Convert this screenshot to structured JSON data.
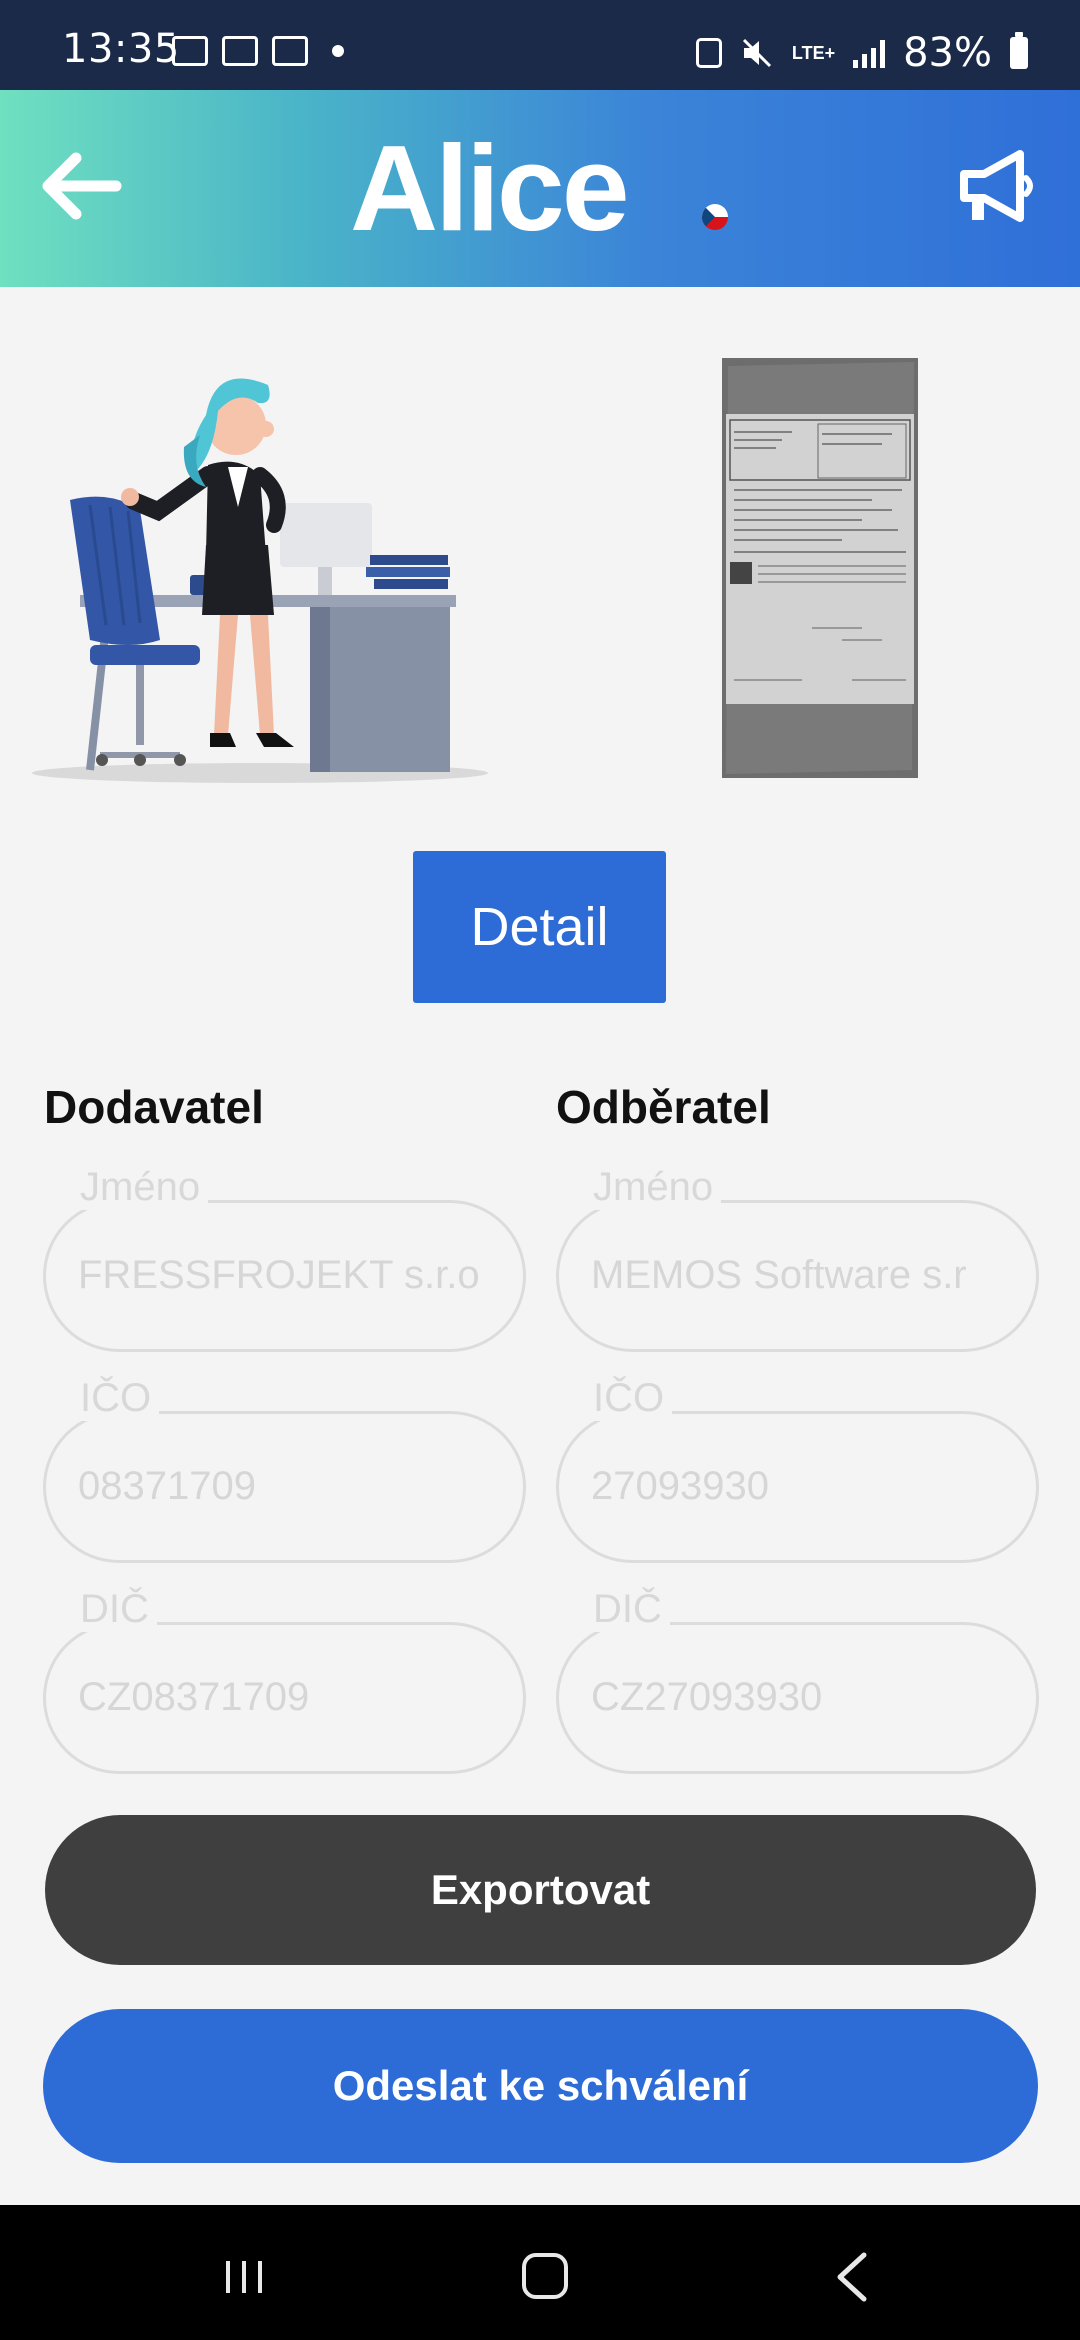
{
  "status_bar": {
    "time": "13:35",
    "network": "LTE+",
    "battery": "83%",
    "notification_icons": [
      "outlook-icon",
      "image-icon",
      "outlook-icon",
      "dot-icon"
    ],
    "system_icons": [
      "nfc-icon",
      "mute-icon",
      "lte-icon",
      "signal-icon",
      "battery-icon"
    ]
  },
  "app_bar": {
    "logo": "Alice",
    "back_icon": "arrow-left-icon",
    "action_icon": "megaphone-icon",
    "brand_gradient": [
      "#6fe0c0",
      "#2f6fd8"
    ]
  },
  "detail_button": "Detail",
  "supplier": {
    "title": "Dodavatel",
    "fields": [
      {
        "label": "Jméno",
        "value": "FRESSFROJEKT s.r.o"
      },
      {
        "label": "IČO",
        "value": "08371709"
      },
      {
        "label": "DIČ",
        "value": "CZ08371709"
      }
    ]
  },
  "customer": {
    "title": "Odběratel",
    "fields": [
      {
        "label": "Jméno",
        "value": "MEMOS Software s.r"
      },
      {
        "label": "IČO",
        "value": "27093930"
      },
      {
        "label": "DIČ",
        "value": "CZ27093930"
      }
    ]
  },
  "actions": {
    "export": "Exportovat",
    "send_for_approval": "Odeslat ke schválení"
  },
  "colors": {
    "primary": "#2d6bd6",
    "dark_button": "#3f3f3f",
    "status_bar": "#1b2a48"
  },
  "nav_bar": {
    "icons": [
      "recent-apps-icon",
      "home-icon",
      "back-icon"
    ]
  }
}
